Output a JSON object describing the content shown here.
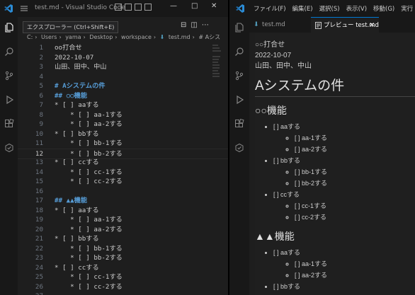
{
  "left_window": {
    "title": "test.md - Visual Studio Code",
    "tooltip": "エクスプローラー (Ctrl+Shift+E)",
    "breadcrumb": [
      "C:",
      "Users",
      "yama",
      "Desktop",
      "workspace",
      "test.md",
      "# Aシス"
    ],
    "lines": [
      {
        "n": "1",
        "t": "oo打合せ"
      },
      {
        "n": "2",
        "t": "2022-10-07"
      },
      {
        "n": "3",
        "t": "山田、田中、中山"
      },
      {
        "n": "4",
        "t": ""
      },
      {
        "n": "5",
        "t": "# Aシステムの件",
        "kind": "h"
      },
      {
        "n": "6",
        "t": "## ○○機能",
        "kind": "h"
      },
      {
        "n": "7",
        "t": "* [ ] aaする",
        "kind": "b"
      },
      {
        "n": "8",
        "t": "    * [ ] aa-1する",
        "kind": "b"
      },
      {
        "n": "9",
        "t": "    * [ ] aa-2する",
        "kind": "b"
      },
      {
        "n": "10",
        "t": "* [ ] bbする",
        "kind": "b"
      },
      {
        "n": "11",
        "t": "    * [ ] bb-1する",
        "kind": "b"
      },
      {
        "n": "12",
        "t": "    * [ ] bb-2する",
        "kind": "b",
        "active": true
      },
      {
        "n": "13",
        "t": "* [ ] ccする",
        "kind": "b"
      },
      {
        "n": "14",
        "t": "    * [ ] cc-1する",
        "kind": "b"
      },
      {
        "n": "15",
        "t": "    * [ ] cc-2する",
        "kind": "b"
      },
      {
        "n": "16",
        "t": ""
      },
      {
        "n": "17",
        "t": "## ▲▲機能",
        "kind": "h"
      },
      {
        "n": "18",
        "t": "* [ ] aaする",
        "kind": "b"
      },
      {
        "n": "19",
        "t": "    * [ ] aa-1する",
        "kind": "b"
      },
      {
        "n": "20",
        "t": "    * [ ] aa-2する",
        "kind": "b"
      },
      {
        "n": "21",
        "t": "* [ ] bbする",
        "kind": "b"
      },
      {
        "n": "22",
        "t": "    * [ ] bb-1する",
        "kind": "b"
      },
      {
        "n": "23",
        "t": "    * [ ] bb-2する",
        "kind": "b"
      },
      {
        "n": "24",
        "t": "* [ ] ccする",
        "kind": "b"
      },
      {
        "n": "25",
        "t": "    * [ ] cc-1する",
        "kind": "b"
      },
      {
        "n": "26",
        "t": "    * [ ] cc-2する",
        "kind": "b"
      },
      {
        "n": "27",
        "t": ""
      }
    ]
  },
  "right_window": {
    "menu": [
      "ファイル(F)",
      "編集(E)",
      "選択(S)",
      "表示(V)",
      "移動(G)",
      "実行"
    ],
    "tabs": {
      "file": "test.md",
      "preview": "プレビュー test.md"
    },
    "preview": {
      "p1": "○○打合せ",
      "p2": "2022-10-07",
      "p3": "山田、田中、中山",
      "h1": "Aシステムの件",
      "sections": [
        {
          "title": "○○機能",
          "items": [
            {
              "label": "[ ] aaする",
              "children": [
                "[ ] aa-1する",
                "[ ] aa-2する"
              ]
            },
            {
              "label": "[ ] bbする",
              "children": [
                "[ ] bb-1する",
                "[ ] bb-2する"
              ]
            },
            {
              "label": "[ ] ccする",
              "children": [
                "[ ] cc-1する",
                "[ ] cc-2する"
              ]
            }
          ]
        },
        {
          "title": "▲▲機能",
          "items": [
            {
              "label": "[ ] aaする",
              "children": [
                "[ ] aa-1する",
                "[ ] aa-2する"
              ]
            },
            {
              "label": "[ ] bbする",
              "children": []
            }
          ]
        }
      ]
    }
  },
  "colors": {
    "accent": "#0078d4",
    "heading": "#569cd6",
    "bullet": "#6796e6",
    "background": "#1e1e1e"
  }
}
